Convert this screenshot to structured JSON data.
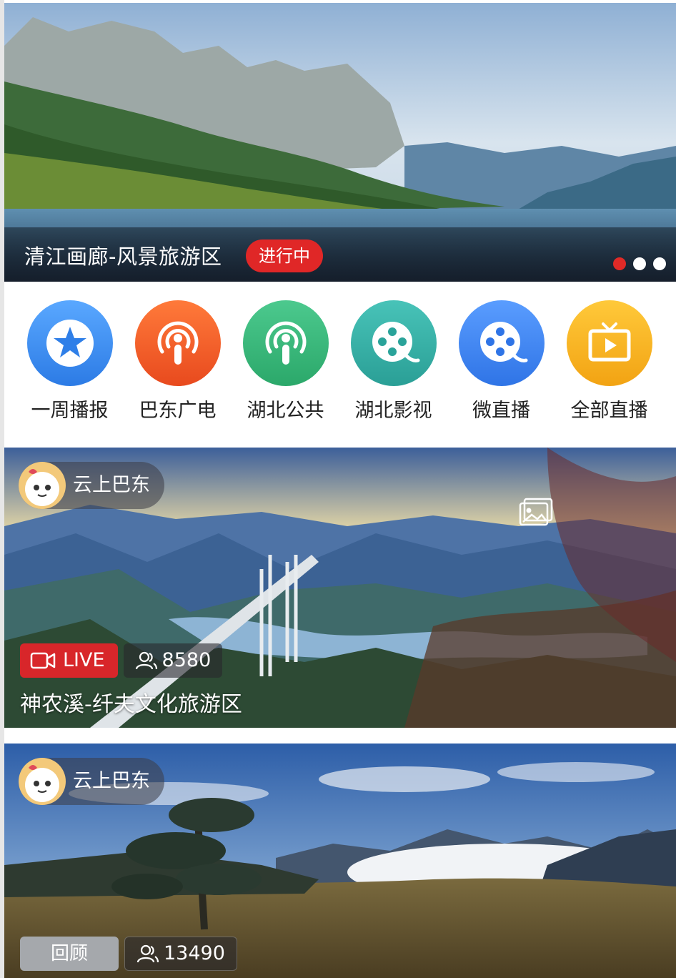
{
  "banner": {
    "title": "清江画廊-风景旅游区",
    "status": "进行中",
    "slide_count": 3,
    "active_slide": 0
  },
  "categories": [
    {
      "label": "一周播报",
      "icon": "star-icon",
      "color": "#3d8ef0"
    },
    {
      "label": "巴东广电",
      "icon": "podcast-icon",
      "color": "#f05a28"
    },
    {
      "label": "湖北公共",
      "icon": "podcast-icon",
      "color": "#36b37e"
    },
    {
      "label": "湖北影视",
      "icon": "film-reel-icon",
      "color": "#36b0a8"
    },
    {
      "label": "微直播",
      "icon": "film-reel-icon",
      "color": "#3b86f0"
    },
    {
      "label": "全部直播",
      "icon": "tv-play-icon",
      "color": "#f5b21f"
    }
  ],
  "cards": [
    {
      "author": "云上巴东",
      "status": "LIVE",
      "viewers": "8580",
      "title": "神农溪-纤夫文化旅游区"
    },
    {
      "author": "云上巴东",
      "status": "回顾",
      "viewers": "13490",
      "title": ""
    }
  ],
  "colors": {
    "live_red": "#d8262a",
    "active_dot": "#e02a27"
  }
}
